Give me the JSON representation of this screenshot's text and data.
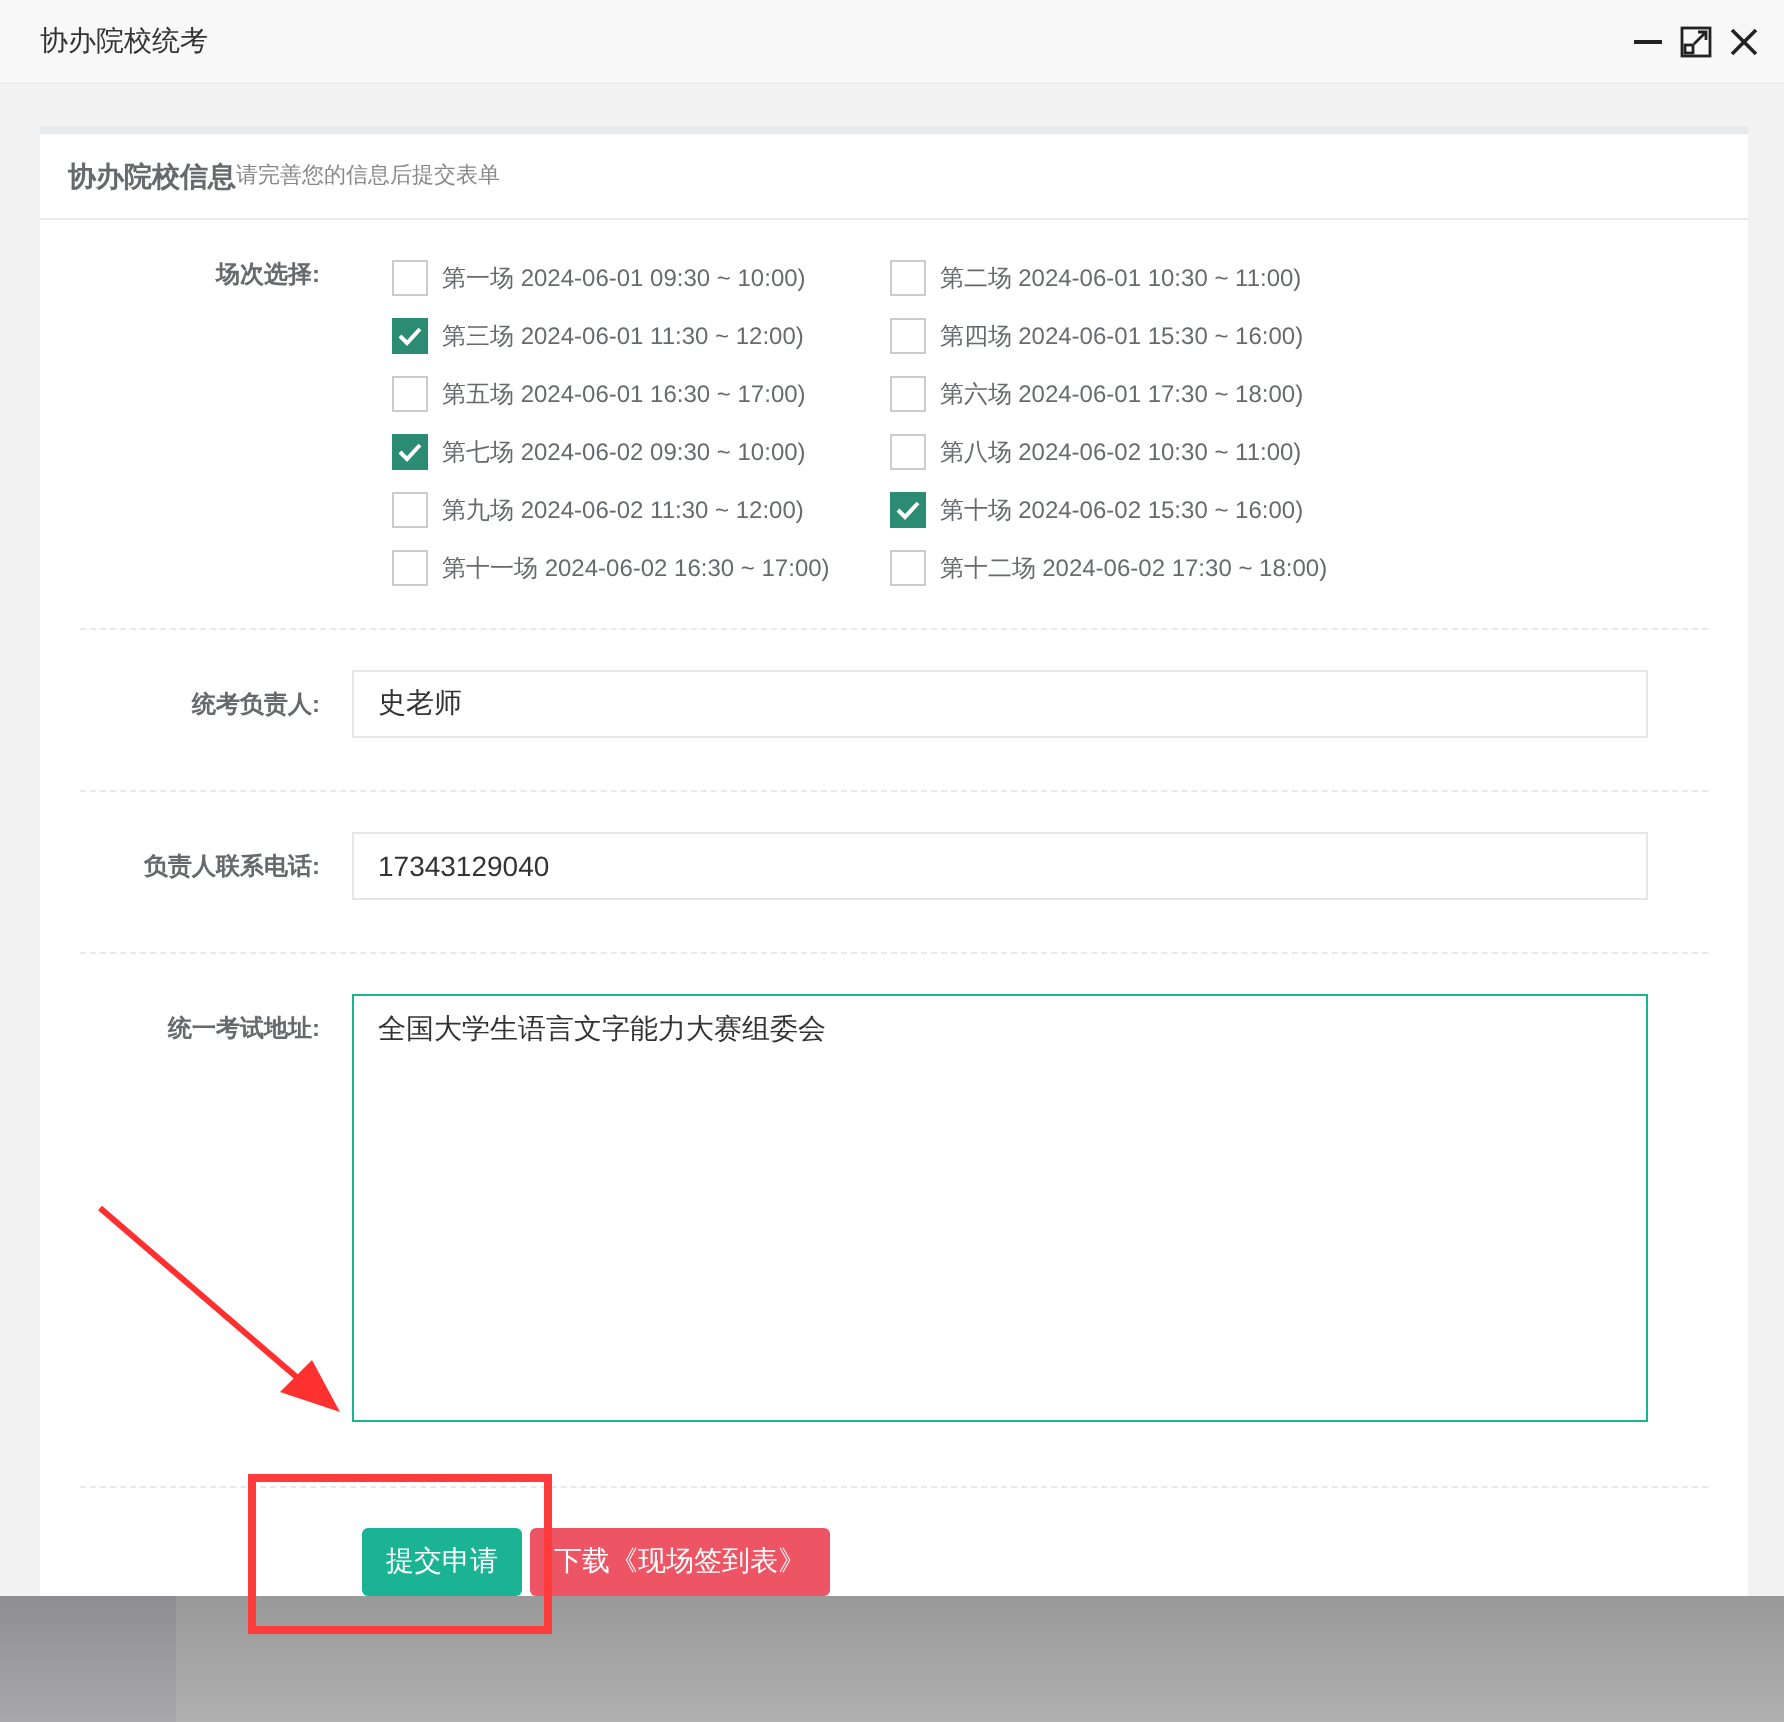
{
  "window": {
    "title": "协办院校统考"
  },
  "card": {
    "title": "协办院校信息",
    "subtitle": "请完善您的信息后提交表单"
  },
  "sessions_label": "场次选择:",
  "sessions": [
    {
      "label": "第一场 2024-06-01 09:30 ~ 10:00)",
      "checked": false
    },
    {
      "label": "第二场 2024-06-01 10:30 ~ 11:00)",
      "checked": false
    },
    {
      "label": "第三场 2024-06-01 11:30 ~ 12:00)",
      "checked": true
    },
    {
      "label": "第四场 2024-06-01 15:30 ~ 16:00)",
      "checked": false
    },
    {
      "label": "第五场 2024-06-01 16:30 ~ 17:00)",
      "checked": false
    },
    {
      "label": "第六场 2024-06-01 17:30 ~ 18:00)",
      "checked": false
    },
    {
      "label": "第七场 2024-06-02 09:30 ~ 10:00)",
      "checked": true
    },
    {
      "label": "第八场 2024-06-02 10:30 ~ 11:00)",
      "checked": false
    },
    {
      "label": "第九场 2024-06-02 11:30 ~ 12:00)",
      "checked": false
    },
    {
      "label": "第十场 2024-06-02 15:30 ~ 16:00)",
      "checked": true
    },
    {
      "label": "第十一场 2024-06-02 16:30 ~ 17:00)",
      "checked": false
    },
    {
      "label": "第十二场 2024-06-02 17:30 ~ 18:00)",
      "checked": false
    }
  ],
  "fields": [
    {
      "kind": "input",
      "label": "统考负责人:",
      "value": "史老师"
    },
    {
      "kind": "input",
      "label": "负责人联系电话:",
      "value": "17343129040"
    },
    {
      "kind": "textarea",
      "label": "统一考试地址:",
      "value": "全国大学生语言文字能力大赛组委会"
    }
  ],
  "buttons": [
    {
      "kind": "primary",
      "label": "提交申请"
    },
    {
      "kind": "danger",
      "label": "下载《现场签到表》"
    }
  ]
}
